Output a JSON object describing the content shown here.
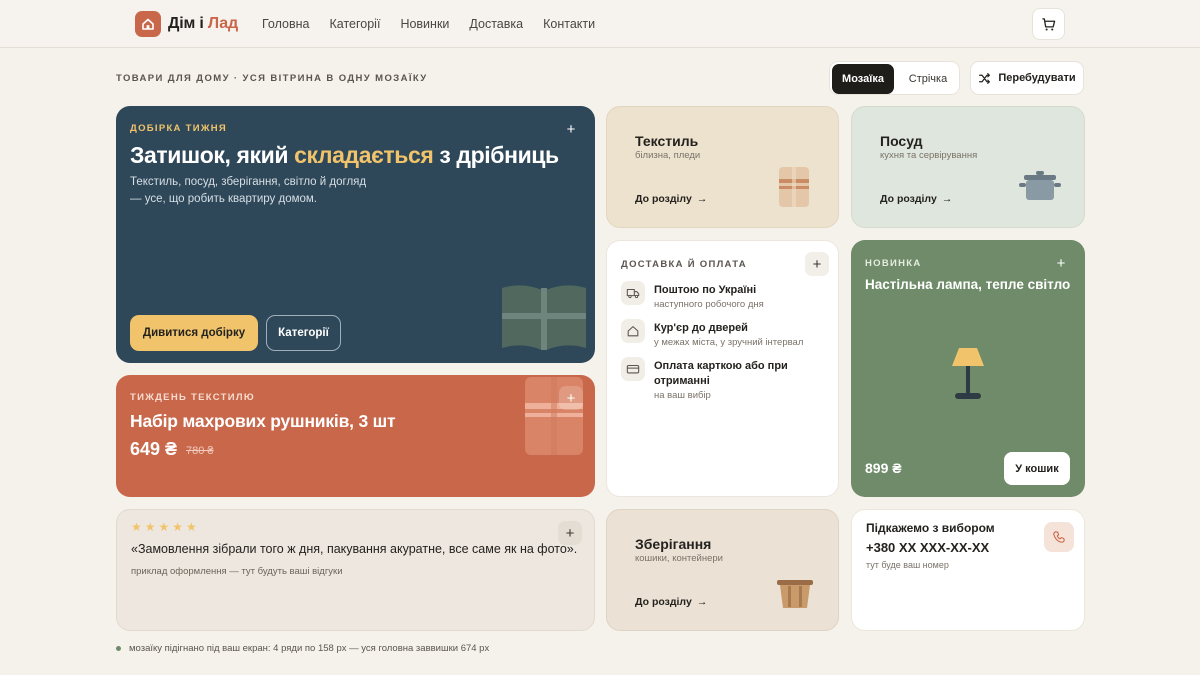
{
  "brand": {
    "name_part1": "Дім і",
    "name_part2": "Лад",
    "icon": "house-icon"
  },
  "nav": [
    "Головна",
    "Категорії",
    "Новинки",
    "Доставка",
    "Контакти"
  ],
  "header": {
    "cart_icon": "cart-icon"
  },
  "toolbar": {
    "subtitle": "ТОВАРИ ДЛЯ ДОМУ · УСЯ ВІТРИНА В ОДНУ МОЗАЇКУ",
    "view_mosaic": "Мозаїка",
    "view_feed": "Стрічка",
    "rebuild": "Перебудувати"
  },
  "hero": {
    "kicker": "ДОБІРКА ТИЖНЯ",
    "title_start": "Затишок, який ",
    "title_highlight": "складається",
    "title_end": " з дрібниць",
    "description": "Текстиль, посуд, зберігання, світло й догляд — усе, що робить квартиру домом.",
    "primary_button": "Дивитися добірку",
    "secondary_button": "Категорії"
  },
  "promo": {
    "kicker": "ТИЖДЕНЬ ТЕКСТИЛЮ",
    "title": "Набір махрових рушників, 3 шт",
    "price": "649 ₴",
    "old_price": "780 ₴"
  },
  "review": {
    "stars": "★★★★★",
    "quote": "«Замовлення зібрали того ж дня, пакування акуратне, все саме як на фото».",
    "note": "приклад оформлення — тут будуть ваші відгуки"
  },
  "categories": {
    "textile": {
      "title": "Текстиль",
      "subtitle": "білизна, пледи",
      "link": "До розділу"
    },
    "dishes": {
      "title": "Посуд",
      "subtitle": "кухня та сервірування",
      "link": "До розділу"
    },
    "storage": {
      "title": "Зберігання",
      "subtitle": "кошики, контейнери",
      "link": "До розділу"
    }
  },
  "delivery": {
    "kicker": "ДОСТАВКА Й ОПЛАТА",
    "items": [
      {
        "title": "Поштою по Україні",
        "subtitle": "наступного робочого дня",
        "icon": "truck-icon"
      },
      {
        "title": "Кур'єр до дверей",
        "subtitle": "у межах міста, у зручний інтервал",
        "icon": "home-icon"
      },
      {
        "title": "Оплата карткою або при отриманні",
        "subtitle": "на ваш вибір",
        "icon": "card-icon"
      }
    ]
  },
  "new_item": {
    "kicker": "НОВИНКА",
    "title": "Настільна лампа, тепле світло",
    "price": "899 ₴",
    "button": "У кошик"
  },
  "contact": {
    "heading": "Підкажемо з вибором",
    "phone": "+380 XX XXX-XX-XX",
    "note": "тут буде ваш номер"
  },
  "footer": {
    "text": "мозаїку підігнано під ваш екран: 4 ряди по 158 px — уся головна заввишки 674 px"
  },
  "colors": {
    "accent": "#c8674a",
    "navy": "#2f4859",
    "gold": "#f1c46b",
    "green": "#6f8b69"
  }
}
